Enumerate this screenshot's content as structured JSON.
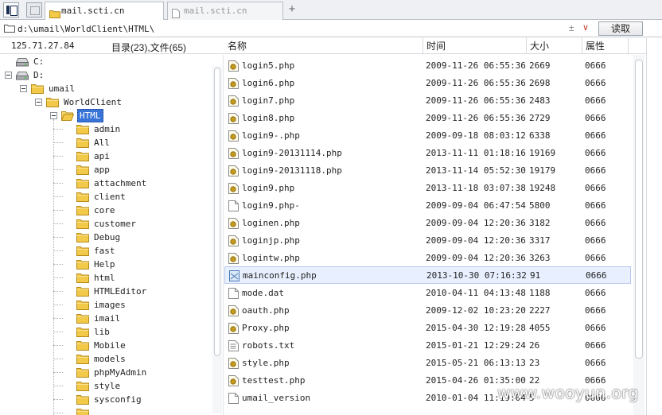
{
  "tabs": [
    {
      "label": "mail.scti.cn",
      "active": true
    },
    {
      "label": "mail.scti.cn",
      "active": false
    }
  ],
  "new_tab_label": "+",
  "address": {
    "path": "d:\\umail\\WorldClient\\HTML\\",
    "sync_glyph": "±",
    "dropdown_glyph": "∨",
    "read_button": "读取"
  },
  "header": {
    "ip": "125.71.27.84",
    "counts": "目录(23),文件(65)",
    "columns": {
      "name": "名称",
      "time": "时间",
      "size": "大小",
      "attr": "属性"
    }
  },
  "tree": [
    {
      "label": "C:",
      "kind": "drive",
      "level": 0,
      "expander": "none"
    },
    {
      "label": "D:",
      "kind": "drive",
      "level": 0,
      "expander": "minus"
    },
    {
      "label": "umail",
      "kind": "folder",
      "level": 1,
      "expander": "minus"
    },
    {
      "label": "WorldClient",
      "kind": "folder",
      "level": 2,
      "expander": "minus"
    },
    {
      "label": "HTML",
      "kind": "folder-open",
      "level": 3,
      "expander": "minus",
      "selected": true
    },
    {
      "label": "admin",
      "kind": "folder",
      "level": 4
    },
    {
      "label": "All",
      "kind": "folder",
      "level": 4
    },
    {
      "label": "api",
      "kind": "folder",
      "level": 4
    },
    {
      "label": "app",
      "kind": "folder",
      "level": 4
    },
    {
      "label": "attachment",
      "kind": "folder",
      "level": 4
    },
    {
      "label": "client",
      "kind": "folder",
      "level": 4
    },
    {
      "label": "core",
      "kind": "folder",
      "level": 4
    },
    {
      "label": "customer",
      "kind": "folder",
      "level": 4
    },
    {
      "label": "Debug",
      "kind": "folder",
      "level": 4
    },
    {
      "label": "fast",
      "kind": "folder",
      "level": 4
    },
    {
      "label": "Help",
      "kind": "folder",
      "level": 4
    },
    {
      "label": "html",
      "kind": "folder",
      "level": 4
    },
    {
      "label": "HTMLEditor",
      "kind": "folder",
      "level": 4
    },
    {
      "label": "images",
      "kind": "folder",
      "level": 4
    },
    {
      "label": "imail",
      "kind": "folder",
      "level": 4
    },
    {
      "label": "lib",
      "kind": "folder",
      "level": 4
    },
    {
      "label": "Mobile",
      "kind": "folder",
      "level": 4
    },
    {
      "label": "models",
      "kind": "folder",
      "level": 4
    },
    {
      "label": "phpMyAdmin",
      "kind": "folder",
      "level": 4
    },
    {
      "label": "style",
      "kind": "folder",
      "level": 4
    },
    {
      "label": "sysconfig",
      "kind": "folder",
      "level": 4
    },
    {
      "label": "",
      "kind": "folder",
      "level": 4
    }
  ],
  "files": [
    {
      "name": "login5.php",
      "time": "2009-11-26 06:55:36",
      "size": "2669",
      "attr": "0666",
      "icon": "php-icon"
    },
    {
      "name": "login6.php",
      "time": "2009-11-26 06:55:36",
      "size": "2698",
      "attr": "0666",
      "icon": "php-icon"
    },
    {
      "name": "login7.php",
      "time": "2009-11-26 06:55:36",
      "size": "2483",
      "attr": "0666",
      "icon": "php-icon"
    },
    {
      "name": "login8.php",
      "time": "2009-11-26 06:55:36",
      "size": "2729",
      "attr": "0666",
      "icon": "php-icon"
    },
    {
      "name": "login9-.php",
      "time": "2009-09-18 08:03:12",
      "size": "6338",
      "attr": "0666",
      "icon": "php-icon"
    },
    {
      "name": "login9-20131114.php",
      "time": "2013-11-11 01:18:16",
      "size": "19169",
      "attr": "0666",
      "icon": "php-icon"
    },
    {
      "name": "login9-20131118.php",
      "time": "2013-11-14 05:52:30",
      "size": "19179",
      "attr": "0666",
      "icon": "php-icon"
    },
    {
      "name": "login9.php",
      "time": "2013-11-18 03:07:38",
      "size": "19248",
      "attr": "0666",
      "icon": "php-icon"
    },
    {
      "name": "login9.php-",
      "time": "2009-09-04 06:47:54",
      "size": "5800",
      "attr": "0666",
      "icon": "blank-file-icon"
    },
    {
      "name": "loginen.php",
      "time": "2009-09-04 12:20:36",
      "size": "3182",
      "attr": "0666",
      "icon": "php-icon"
    },
    {
      "name": "loginjp.php",
      "time": "2009-09-04 12:20:36",
      "size": "3317",
      "attr": "0666",
      "icon": "php-icon"
    },
    {
      "name": "logintw.php",
      "time": "2009-09-04 12:20:36",
      "size": "3263",
      "attr": "0666",
      "icon": "php-icon"
    },
    {
      "name": "mainconfig.php",
      "time": "2013-10-30 07:16:32",
      "size": "91",
      "attr": "0666",
      "icon": "config-file-icon",
      "selected": true
    },
    {
      "name": "mode.dat",
      "time": "2010-04-11 04:13:48",
      "size": "1188",
      "attr": "0666",
      "icon": "blank-file-icon"
    },
    {
      "name": "oauth.php",
      "time": "2009-12-02 10:23:20",
      "size": "2227",
      "attr": "0666",
      "icon": "php-icon"
    },
    {
      "name": "Proxy.php",
      "time": "2015-04-30 12:19:28",
      "size": "4055",
      "attr": "0666",
      "icon": "php-icon"
    },
    {
      "name": "robots.txt",
      "time": "2015-01-21 12:29:24",
      "size": "26",
      "attr": "0666",
      "icon": "text-file-icon"
    },
    {
      "name": "style.php",
      "time": "2015-05-21 06:13:13",
      "size": "23",
      "attr": "0666",
      "icon": "php-icon"
    },
    {
      "name": "testtest.php",
      "time": "2015-04-26 01:35:00",
      "size": "22",
      "attr": "0666",
      "icon": "php-icon"
    },
    {
      "name": "umail_version",
      "time": "2010-01-04 11:19:04",
      "size": "5",
      "attr": "0666",
      "icon": "blank-file-icon"
    }
  ],
  "watermark": "www.wooyun.org",
  "colors": {
    "selection": "#3874d8",
    "row_selected": "#e8efff",
    "folder": "#f3c94a"
  }
}
